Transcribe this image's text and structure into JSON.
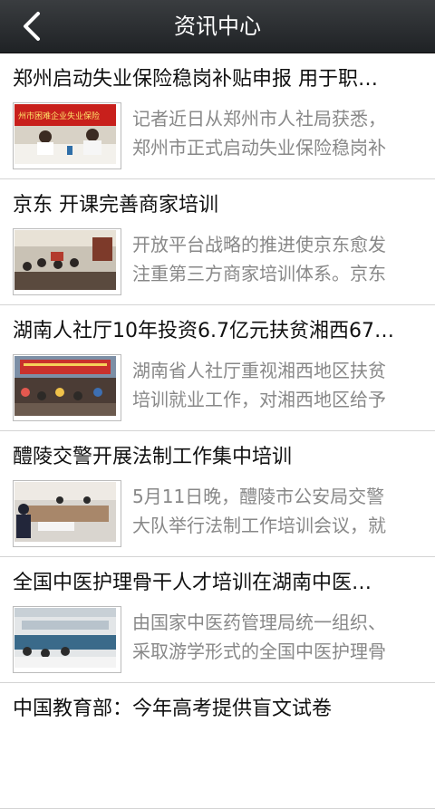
{
  "header": {
    "title": "资讯中心",
    "back_icon": "chevron-left-icon"
  },
  "news": [
    {
      "title": "郑州启动失业保险稳岗补贴申报 用于职…",
      "summary_line1": "记者近日从郑州市人社局获悉，",
      "summary_line2": "郑州市正式启动失业保险稳岗补",
      "thumb_caption": "州市困难企业失业保险"
    },
    {
      "title": "京东 开课完善商家培训",
      "summary_line1": "开放平台战略的推进使京东愈发",
      "summary_line2": "注重第三方商家培训体系。京东"
    },
    {
      "title": "湖南人社厅10年投资6.7亿元扶贫湘西67…",
      "summary_line1": "湖南省人社厅重视湘西地区扶贫",
      "summary_line2": "培训就业工作，对湘西地区给予"
    },
    {
      "title": "醴陵交警开展法制工作集中培训",
      "summary_line1": "5月11日晚，醴陵市公安局交警",
      "summary_line2": "大队举行法制工作培训会议，就"
    },
    {
      "title": "全国中医护理骨干人才培训在湖南中医…",
      "summary_line1": "由国家中医药管理局统一组织、",
      "summary_line2": "采取游学形式的全国中医护理骨"
    },
    {
      "title": "中国教育部：今年高考提供盲文试卷"
    }
  ]
}
